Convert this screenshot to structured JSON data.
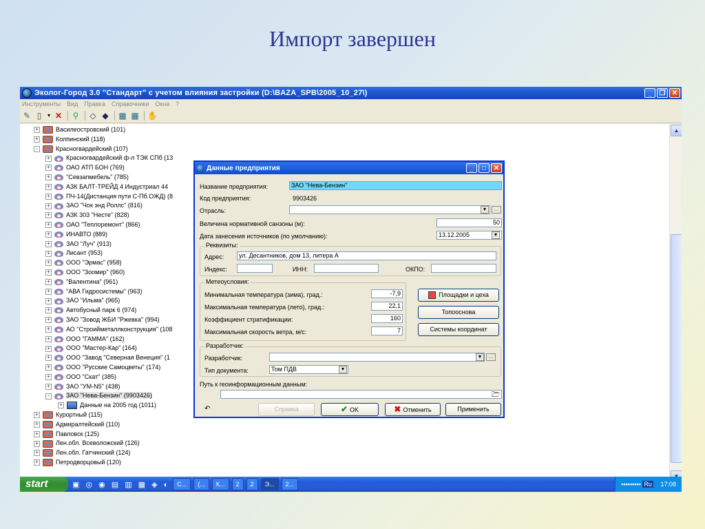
{
  "slide": {
    "title": "Импорт завершен"
  },
  "window": {
    "title": "Эколог-Город 3.0 \"Стандарт\" с учетом влияния застройки (D:\\BAZA_SPB\\2005_10_27\\)",
    "menu": [
      "Инструменты",
      "Вид",
      "Правка",
      "Справочники",
      "Окна",
      "?"
    ],
    "toolbar_icons": [
      "new-record-icon",
      "new-document-icon",
      "dropdown-icon",
      "delete-icon",
      "search-icon",
      "link-icon",
      "pencil-icon",
      "import-icon",
      "export-icon",
      "calculate-icon"
    ]
  },
  "tree": [
    {
      "label": "Василеостровский (101)",
      "level": 0,
      "type": "region",
      "exp": "+"
    },
    {
      "label": "Колпинский (118)",
      "level": 0,
      "type": "region",
      "exp": "+"
    },
    {
      "label": "Красногвардейский (107)",
      "level": 0,
      "type": "region",
      "exp": "-"
    },
    {
      "label": "Красногвардейский ф-л ТЭК СПб (13",
      "level": 1,
      "type": "ent",
      "exp": "+"
    },
    {
      "label": "ОАО АТП БОН (769)",
      "level": 1,
      "type": "ent",
      "exp": "+"
    },
    {
      "label": "\"Севзапмебель\" (785)",
      "level": 1,
      "type": "ent",
      "exp": "+"
    },
    {
      "label": "АЗК БАЛТ-ТРЕЙД 4 Индустриал 44",
      "level": 1,
      "type": "ent",
      "exp": "+"
    },
    {
      "label": "ПЧ-14(Дистанция пути С-Пб.ОЖД) (8",
      "level": 1,
      "type": "ent",
      "exp": "+"
    },
    {
      "label": "ЗАО \"Чок энд Роллс\" (816)",
      "level": 1,
      "type": "ent",
      "exp": "+"
    },
    {
      "label": "АЗК 303 \"Несте\" (828)",
      "level": 1,
      "type": "ent",
      "exp": "+"
    },
    {
      "label": "ОАО \"Теплоремонт\" (866)",
      "level": 1,
      "type": "ent",
      "exp": "+"
    },
    {
      "label": "ИНАВТО (889)",
      "level": 1,
      "type": "ent",
      "exp": "+"
    },
    {
      "label": "ЗАО \"Луч\" (913)",
      "level": 1,
      "type": "ent",
      "exp": "+"
    },
    {
      "label": "Лисант (953)",
      "level": 1,
      "type": "ent",
      "exp": "+"
    },
    {
      "label": "ООО \"Эрмас\" (958)",
      "level": 1,
      "type": "ent",
      "exp": "+"
    },
    {
      "label": "ООО \"Зоомир\" (960)",
      "level": 1,
      "type": "ent",
      "exp": "+"
    },
    {
      "label": "\"Валентина\" (961)",
      "level": 1,
      "type": "ent",
      "exp": "+"
    },
    {
      "label": "\"АВА Гидросистемы\" (963)",
      "level": 1,
      "type": "ent",
      "exp": "+"
    },
    {
      "label": "ЗАО \"Ильма\" (965)",
      "level": 1,
      "type": "ent",
      "exp": "+"
    },
    {
      "label": "Автобусный парк 6 (974)",
      "level": 1,
      "type": "ent",
      "exp": "+"
    },
    {
      "label": "ЗАО \"Зовод ЖБИ \"Ржевка\" (994)",
      "level": 1,
      "type": "ent",
      "exp": "+"
    },
    {
      "label": "АО \"Строийметаллконструкция\" (108",
      "level": 1,
      "type": "ent",
      "exp": "+"
    },
    {
      "label": "ООО \"ГАММА\" (162)",
      "level": 1,
      "type": "ent",
      "exp": "+"
    },
    {
      "label": "ООО \"Мастер-Кар\" (164)",
      "level": 1,
      "type": "ent",
      "exp": "+"
    },
    {
      "label": "ООО \"Завод \"Северная Венеция\" (1",
      "level": 1,
      "type": "ent",
      "exp": "+"
    },
    {
      "label": "ООО \"Русские Самоцветы\" (174)",
      "level": 1,
      "type": "ent",
      "exp": "+"
    },
    {
      "label": "ООО \"Скат\" (385)",
      "level": 1,
      "type": "ent",
      "exp": "+"
    },
    {
      "label": "ЗАО \"УМ-N5\" (438)",
      "level": 1,
      "type": "ent",
      "exp": "+"
    },
    {
      "label": "ЗАО \"Нева-Бензин\" (9903426)",
      "level": 1,
      "type": "ent",
      "exp": "-"
    },
    {
      "label": "Данные на 2005 год (1011)",
      "level": 2,
      "type": "data",
      "exp": "+"
    },
    {
      "label": "Курортный (115)",
      "level": 0,
      "type": "region",
      "exp": "+"
    },
    {
      "label": "Адмиралтейский (110)",
      "level": 0,
      "type": "region",
      "exp": "+"
    },
    {
      "label": "Павловск (125)",
      "level": 0,
      "type": "region",
      "exp": "+"
    },
    {
      "label": "Лен.обл. Всеволожский (126)",
      "level": 0,
      "type": "region",
      "exp": "+"
    },
    {
      "label": "Лен.обл. Гатчинский (124)",
      "level": 0,
      "type": "region",
      "exp": "+"
    },
    {
      "label": "Петродворцовый (120)",
      "level": 0,
      "type": "region",
      "exp": "+"
    }
  ],
  "dialog": {
    "title": "Данные предприятия",
    "name_label": "Название предприятия:",
    "name_value": "ЗАО \"Нева-Бензин\"",
    "code_label": "Код предприятия:",
    "code_value": "9903426",
    "industry_label": "Отрасль:",
    "industry_value": "",
    "sanzone_label": "Величина нормативной санзоны (м):",
    "sanzone_value": "50",
    "date_label": "Дата занесения источников (по умолчанию):",
    "date_value": "13.12.2005",
    "requisites": {
      "group": "Реквизиты:",
      "address_label": "Адрес:",
      "address_value": "ул. Десантников, дом 13, литера А",
      "index_label": "Индекс:",
      "index_value": "",
      "inn_label": "ИНН:",
      "inn_value": "",
      "okpo_label": "ОКПО:",
      "okpo_value": ""
    },
    "meteo": {
      "group": "Метеоусловия:",
      "tmin_label": "Минимальная температура (зима), град.:",
      "tmin_value": "-7,9",
      "tmax_label": "Максимальная температура (лето), град.:",
      "tmax_value": "22,1",
      "strat_label": "Коэффициент стратификации:",
      "strat_value": "160",
      "wind_label": "Максимальная скорость ветра, м/с:",
      "wind_value": "7"
    },
    "buttons": {
      "sites": "Площадки и цеха",
      "topo": "Топооснова",
      "coords": "Системы координат",
      "help": "Справка",
      "ok": "OK",
      "cancel": "Отменить",
      "apply": "Применить"
    },
    "developer": {
      "group": "Разработчик:",
      "dev_label": "Разработчик:",
      "dev_value": "",
      "doctype_label": "Тип документа:",
      "doctype_value": "Том ПДВ"
    },
    "geopath_label": "Путь к геоинформационным данным:",
    "geopath_value": ""
  },
  "taskbar": {
    "start": "start",
    "tasks": [
      "С...",
      "(...",
      "К...",
      "2",
      "2",
      "Э...",
      "2..."
    ],
    "clock": "17:08",
    "tray_lang": "Ru"
  }
}
